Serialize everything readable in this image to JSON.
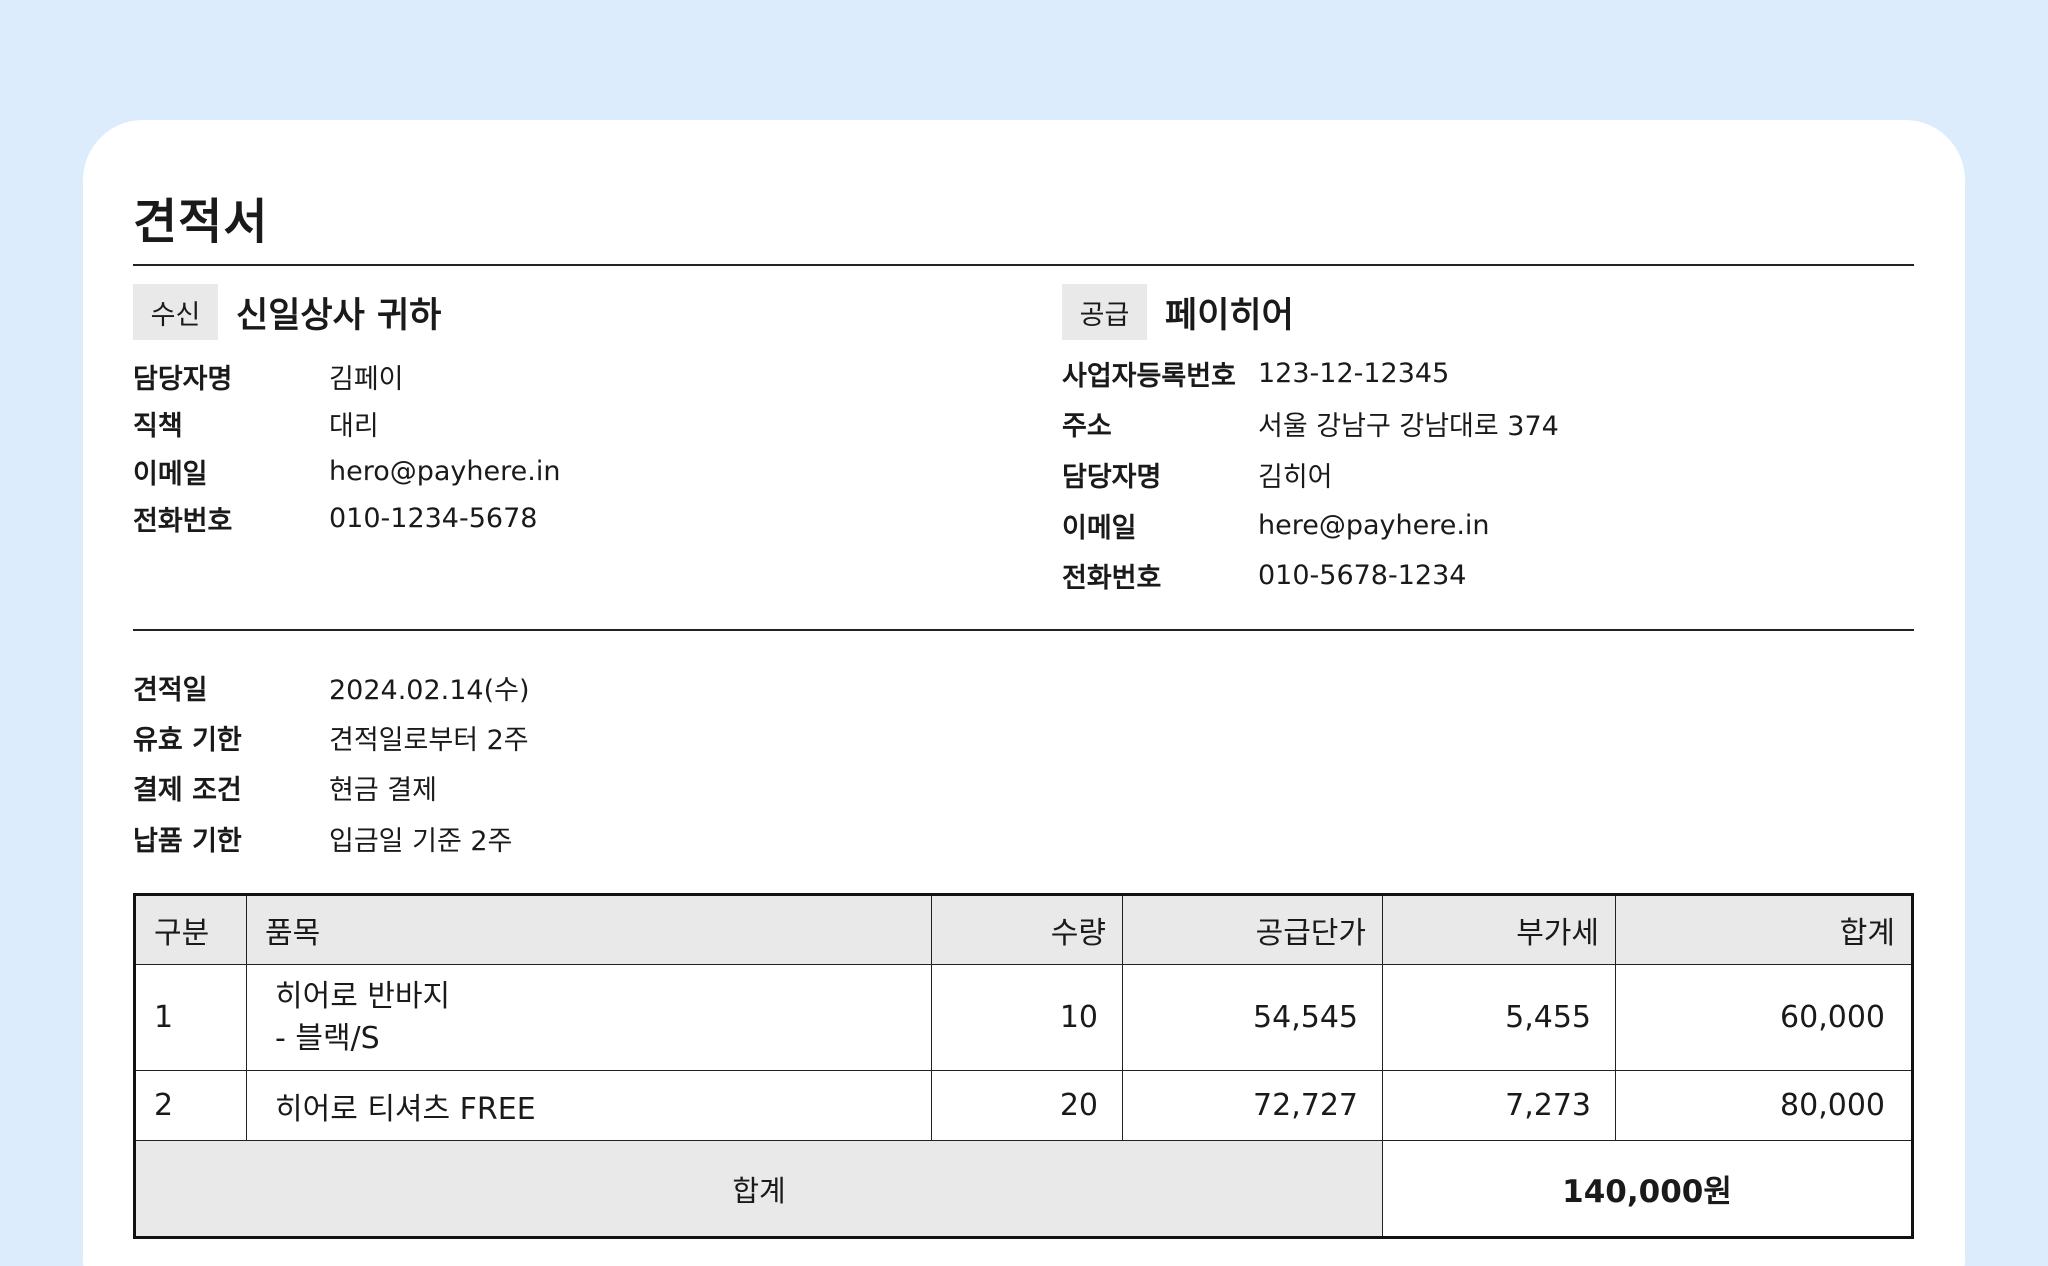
{
  "title": "견적서",
  "recipient": {
    "badge": "수신",
    "name": "신일상사 귀하",
    "fields": [
      {
        "label": "담당자명",
        "value": "김페이"
      },
      {
        "label": "직책",
        "value": "대리"
      },
      {
        "label": "이메일",
        "value": "hero@payhere.in"
      },
      {
        "label": "전화번호",
        "value": "010-1234-5678"
      }
    ]
  },
  "supplier": {
    "badge": "공급",
    "name": "페이히어",
    "fields": [
      {
        "label": "사업자등록번호",
        "value": "123-12-12345"
      },
      {
        "label": "주소",
        "value": "서울 강남구 강남대로 374"
      },
      {
        "label": "담당자명",
        "value": "김히어"
      },
      {
        "label": "이메일",
        "value": "here@payhere.in"
      },
      {
        "label": "전화번호",
        "value": "010-5678-1234"
      }
    ]
  },
  "terms": [
    {
      "label": "견적일",
      "value": "2024.02.14(수)"
    },
    {
      "label": "유효 기한",
      "value": "견적일로부터 2주"
    },
    {
      "label": "결제 조건",
      "value": "현금 결제"
    },
    {
      "label": "납품 기한",
      "value": "입금일 기준 2주"
    }
  ],
  "table": {
    "headers": [
      "구분",
      "품목",
      "수량",
      "공급단가",
      "부가세",
      "합계"
    ],
    "rows": [
      {
        "no": "1",
        "item_line1": "히어로 반바지",
        "item_line2": "- 블랙/S",
        "qty": "10",
        "unit_price": "54,545",
        "vat": "5,455",
        "total": "60,000"
      },
      {
        "no": "2",
        "item_line1": "히어로 티셔츠 FREE",
        "qty": "20",
        "unit_price": "72,727",
        "vat": "7,273",
        "total": "80,000"
      }
    ],
    "sum_label": "합계",
    "sum_value": "140,000원"
  }
}
